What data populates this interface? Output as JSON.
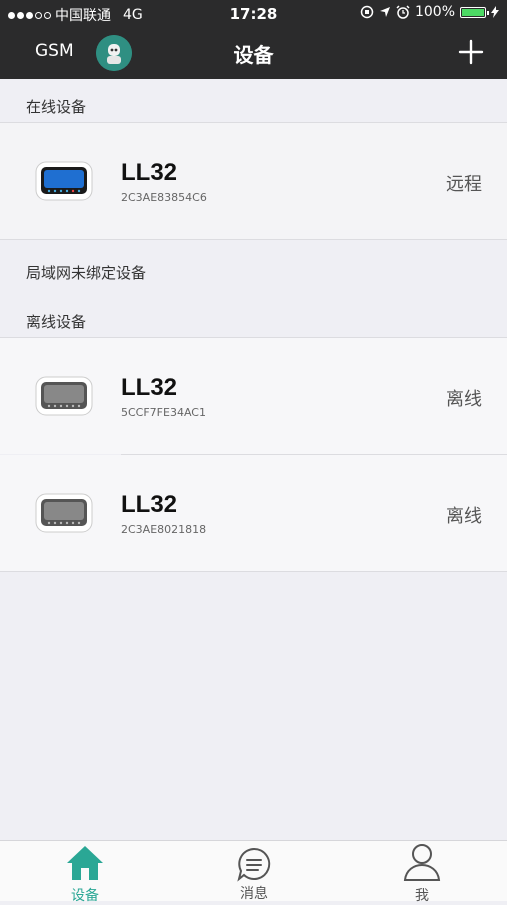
{
  "status_bar": {
    "carrier": "中国联通",
    "network": "4G",
    "time": "17:28",
    "battery": "100%",
    "battery_level": 1.0,
    "signal_bars": 3
  },
  "nav": {
    "left_label": "GSM",
    "title": "设备",
    "add_icon": "plus-icon"
  },
  "sections": {
    "online": "在线设备",
    "lan_unbound": "局域网未绑定设备",
    "offline": "离线设备"
  },
  "online_devices": [
    {
      "name": "LL32",
      "id": "2C3AE83854C6",
      "status": "远程"
    }
  ],
  "offline_devices": [
    {
      "name": "LL32",
      "id": "5CCF7FE34AC1",
      "status": "离线"
    },
    {
      "name": "LL32",
      "id": "2C3AE8021818",
      "status": "离线"
    }
  ],
  "tabs": [
    {
      "label": "设备",
      "icon": "home-icon",
      "active": true
    },
    {
      "label": "消息",
      "icon": "message-icon",
      "active": false
    },
    {
      "label": "我",
      "icon": "user-icon",
      "active": false
    }
  ],
  "colors": {
    "accent": "#2aa795",
    "nav_bg": "#2b2b2c",
    "page_bg": "#efeff4"
  }
}
